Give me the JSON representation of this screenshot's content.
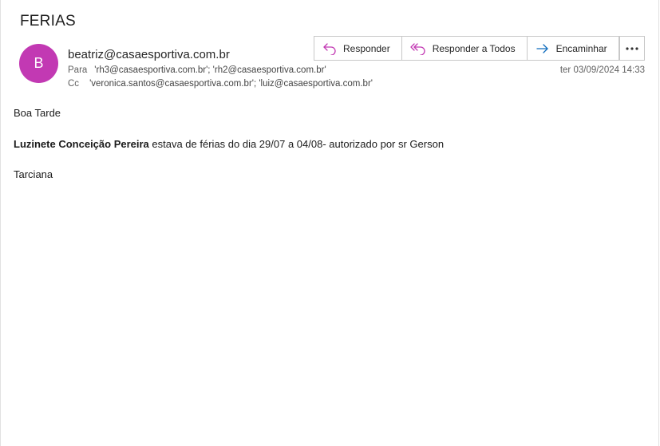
{
  "email": {
    "subject": "FERIAS",
    "avatar_initial": "B",
    "sender": "beatriz@casaesportiva.com.br",
    "to_label": "Para",
    "to_value": "'rh3@casaesportiva.com.br'; 'rh2@casaesportiva.com.br'",
    "cc_label": "Cc",
    "cc_value": "'veronica.santos@casaesportiva.com.br'; 'luiz@casaesportiva.com.br'",
    "timestamp": "ter 03/09/2024 14:33"
  },
  "actions": {
    "reply": "Responder",
    "reply_all": "Responder a Todos",
    "forward": "Encaminhar",
    "more_icon": "more-horizontal-icon"
  },
  "body": {
    "greeting": "Boa Tarde",
    "name_bold": "Luzinete Conceição Pereira",
    "message_rest": " estava de férias do dia 29/07 a 04/08- autorizado por sr Gerson",
    "signature": "Tarciana"
  },
  "colors": {
    "avatar_bg": "#c239b3",
    "reply_icon": "#c239b3",
    "forward_icon": "#0f6cbd"
  }
}
